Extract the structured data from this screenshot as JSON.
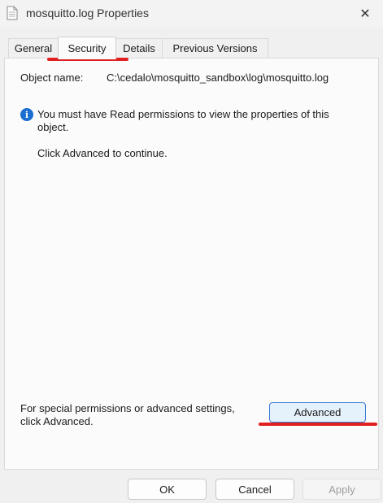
{
  "window": {
    "title": "mosquitto.log Properties",
    "icon": "document-icon",
    "close_icon": "✕"
  },
  "tabs": [
    {
      "label": "General"
    },
    {
      "label": "Security",
      "active": true
    },
    {
      "label": "Details"
    },
    {
      "label": "Previous Versions"
    }
  ],
  "security": {
    "object_name_label": "Object name:",
    "object_name_value": "C:\\cedalo\\mosquitto_sandbox\\log\\mosquitto.log",
    "info_glyph": "i",
    "info_message": "You must have Read permissions to view the properties of this object.",
    "continue_message": "Click Advanced to continue.",
    "special_permissions_text": "For special permissions or advanced settings, click Advanced.",
    "advanced_button": "Advanced"
  },
  "footer": {
    "ok": "OK",
    "cancel": "Cancel",
    "apply": "Apply"
  },
  "colors": {
    "info_icon": "#1a6fd1",
    "annotation_underline": "#e02020"
  }
}
